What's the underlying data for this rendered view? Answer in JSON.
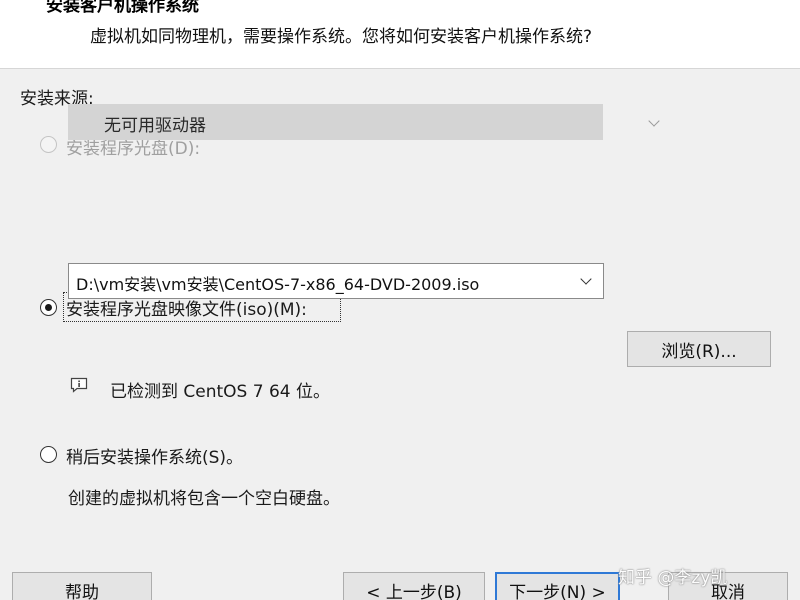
{
  "header": {
    "title": "安装客户机操作系统",
    "subtitle": "虚拟机如同物理机，需要操作系统。您将如何安装客户机操作系统?"
  },
  "install_source": {
    "label": "安装来源:",
    "options": {
      "disc": {
        "label": "安装程序光盘(D):",
        "selected": false,
        "enabled": false,
        "drive_value": "无可用驱动器"
      },
      "iso": {
        "label": "安装程序光盘映像文件(iso)(M):",
        "selected": true,
        "enabled": true,
        "path_value": "D:\\vm安装\\vm安装\\CentOS-7-x86_64-DVD-2009.iso",
        "browse_label": "浏览(R)...",
        "detected_text": "已检测到 CentOS 7 64 位。"
      },
      "later": {
        "label": "稍后安装操作系统(S)。",
        "selected": false,
        "enabled": true,
        "description": "创建的虚拟机将包含一个空白硬盘。"
      }
    }
  },
  "footer": {
    "help_label": "帮助",
    "back_label": "< 上一步(B)",
    "next_label": "下一步(N) >",
    "cancel_label": "取消"
  },
  "watermark": "知乎 @李zy凯",
  "icons": {
    "info": "info-balloon-icon",
    "dropdown": "chevron-down-icon"
  },
  "colors": {
    "accent": "#2f79d6",
    "panel_bg": "#f0f0f0",
    "disabled_text": "#a0a0a0"
  }
}
